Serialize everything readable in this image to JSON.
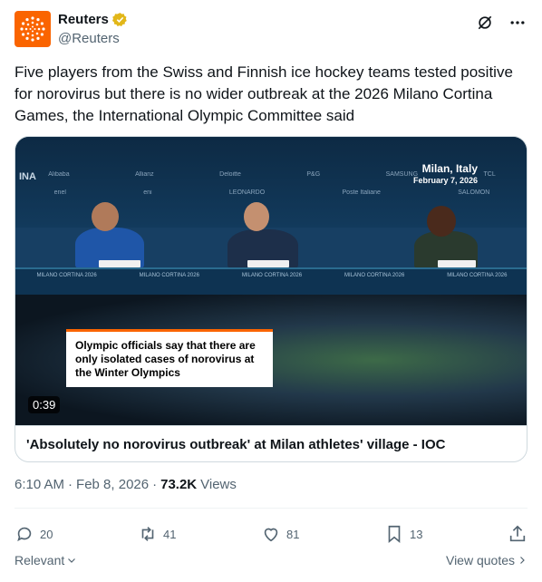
{
  "author": {
    "display_name": "Reuters",
    "handle": "@Reuters",
    "brand_color": "#fa6400",
    "verified_badge": "gold-check"
  },
  "tweet": {
    "text": "Five players from the Swiss and Finnish ice hockey teams tested positive for norovirus but there is no wider outbreak at the 2026 Milano Cortina Games, the International Olympic Committee said"
  },
  "media": {
    "location_city": "Milan, Italy",
    "location_date": "February 7, 2026",
    "caption": "Olympic officials say that there are only isolated cases of norovirus at the Winter Olympics",
    "duration": "0:39",
    "card_title": "'Absolutely no norovirus outbreak' at Milan athletes' village - IOC",
    "backdrop_text": "INA",
    "sponsors_top": [
      "Alibaba",
      "Allianz",
      "Deloitte",
      "P&G",
      "SAMSUNG",
      "TCL"
    ],
    "sponsors_mid": [
      "enel",
      "eni",
      "LEONARDO",
      "Poste Italiane",
      "SALOMON"
    ],
    "table_text": "MILANO CORTINA 2026"
  },
  "meta": {
    "time": "6:10 AM",
    "separator": "·",
    "date": "Feb 8, 2026",
    "views_count": "73.2K",
    "views_label": "Views"
  },
  "actions": {
    "replies": "20",
    "reposts": "41",
    "likes": "81",
    "bookmarks": "13"
  },
  "footer": {
    "relevant_label": "Relevant",
    "view_quotes_label": "View quotes"
  }
}
